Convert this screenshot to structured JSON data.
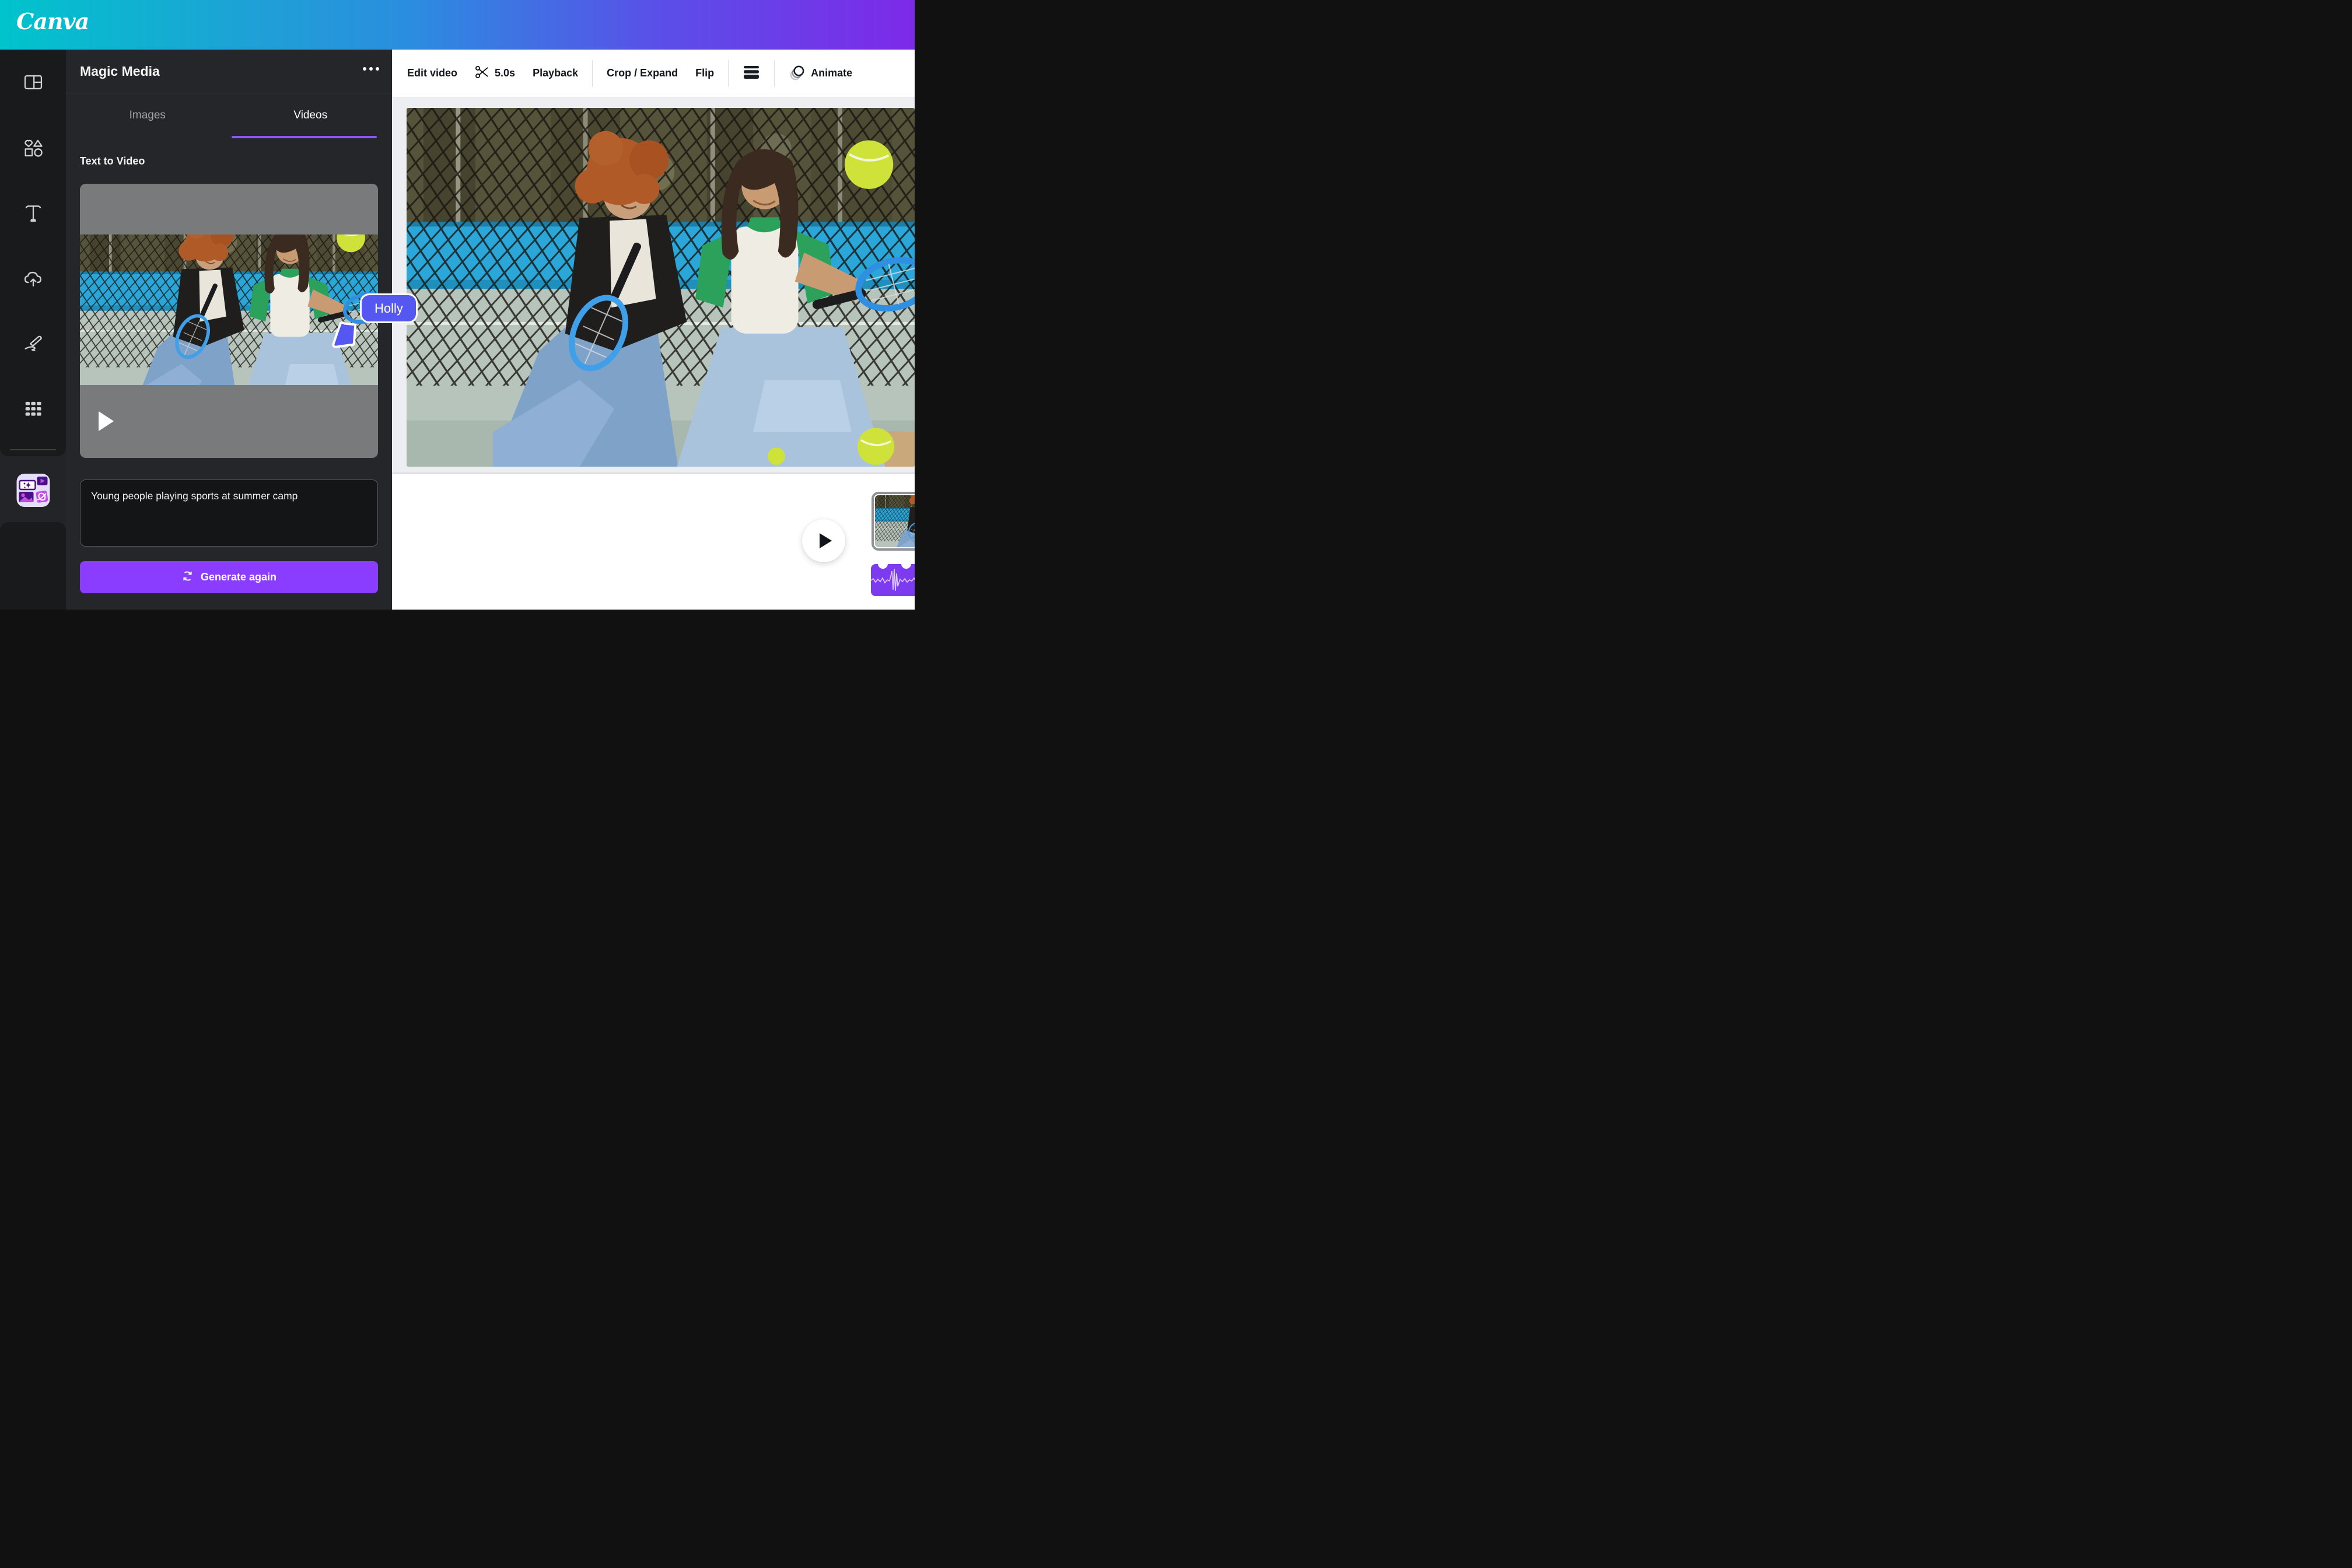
{
  "topbar": {
    "logo_text": "Canva"
  },
  "rail": {
    "items": [
      {
        "name": "design"
      },
      {
        "name": "elements"
      },
      {
        "name": "text"
      },
      {
        "name": "uploads"
      },
      {
        "name": "draw"
      },
      {
        "name": "apps"
      },
      {
        "name": "magic-media-app"
      }
    ]
  },
  "panel": {
    "title": "Magic Media",
    "tabs": {
      "images": "Images",
      "videos": "Videos"
    },
    "section_title": "Text to Video",
    "prompt_value": "Young people playing sports at summer camp",
    "generate_label": "Generate again"
  },
  "toolbar": {
    "edit_video": "Edit video",
    "duration": "5.0s",
    "playback": "Playback",
    "crop_expand": "Crop / Expand",
    "flip": "Flip",
    "animate": "Animate"
  },
  "collaborator": {
    "name": "Holly",
    "color": "#5457f0"
  },
  "timeline": {
    "add_label": "+"
  },
  "icons": {
    "menu": "ellipsis-icon",
    "trim": "scissors-icon",
    "position": "hamburger-icon",
    "animate": "animate-circles-icon",
    "transition": "bowtie-transition-icon",
    "generate": "regenerate-icon",
    "play": "play-icon",
    "add": "plus-icon"
  },
  "colors": {
    "accent_purple": "#8b3dff",
    "audio_purple": "#7c3bee",
    "tab_underline": "#8a57f6",
    "collaborator": "#5457f0",
    "gradient_start": "#00c4cc",
    "gradient_end": "#7d2ae8"
  }
}
